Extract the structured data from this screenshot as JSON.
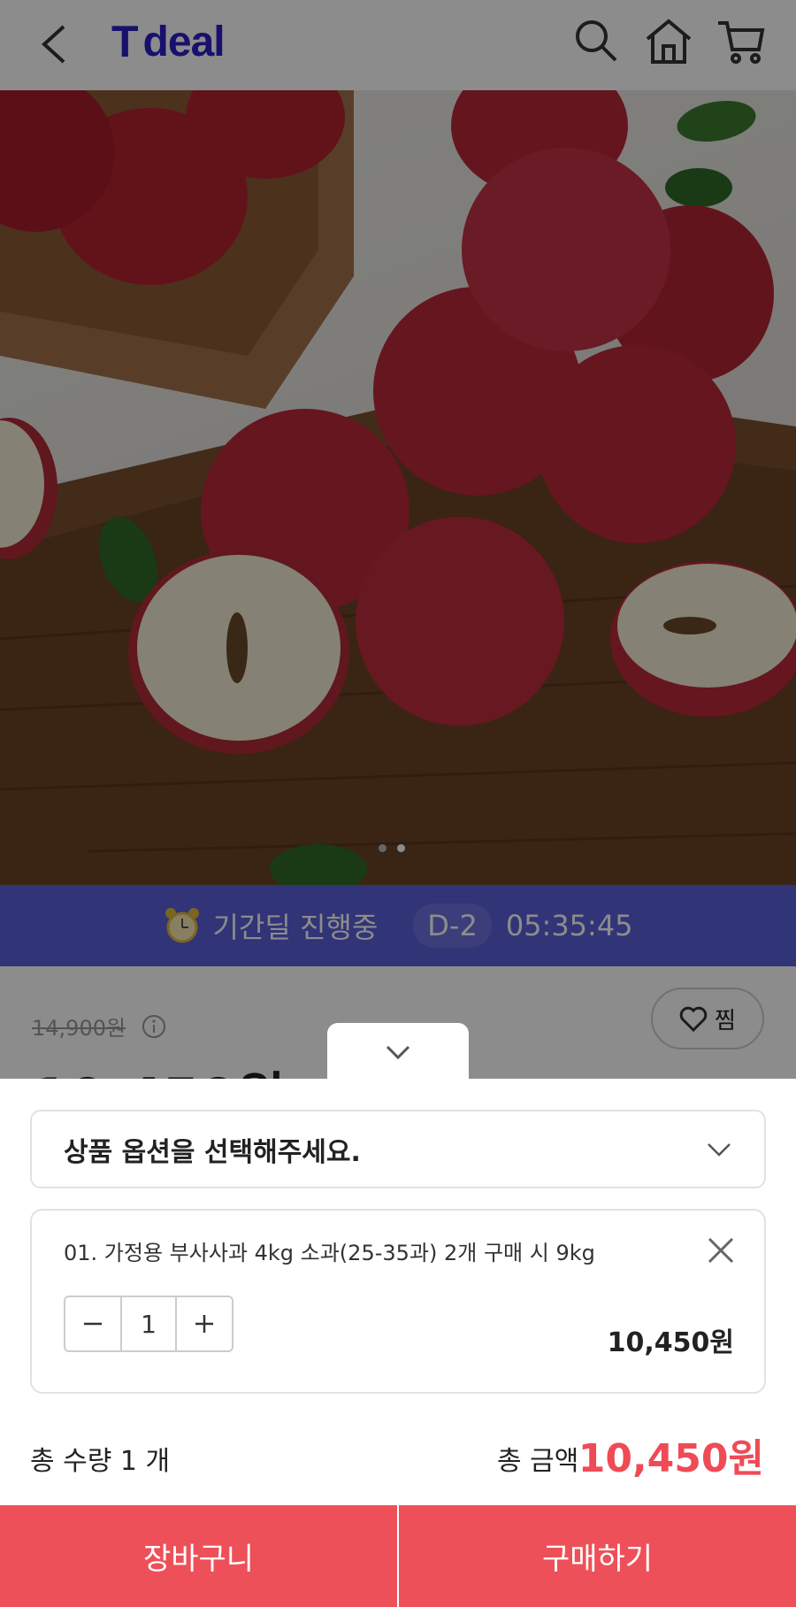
{
  "header": {
    "logo_text": "deal",
    "logo_mark": "T"
  },
  "deal_bar": {
    "status": "기간딜 진행중",
    "dday": "D-2",
    "countdown": "05:35:45"
  },
  "product": {
    "original_price": "14,900원",
    "sale_price": "10,450원",
    "wish_label": "찜"
  },
  "sheet": {
    "select_placeholder": "상품 옵션을 선택해주세요.",
    "option": {
      "name": "01. 가정용 부사사과 4kg 소과(25-35과) 2개 구매 시 9kg",
      "quantity": "1",
      "price": "10,450원"
    },
    "total_quantity": "총 수량 1 개",
    "total_label": "총 금액",
    "total_price": "10,450원"
  },
  "footer": {
    "cart_label": "장바구니",
    "buy_label": "구매하기"
  },
  "colors": {
    "brand": "#2b1fc6",
    "deal_bar": "#5a5fd9",
    "accent": "#ef4b56",
    "cta": "#ee5059"
  },
  "icons": [
    "back-icon",
    "search-icon",
    "home-icon",
    "cart-icon",
    "alarm-clock-icon",
    "info-icon",
    "heart-icon",
    "chevron-down-icon",
    "close-icon",
    "minus-icon",
    "plus-icon"
  ]
}
